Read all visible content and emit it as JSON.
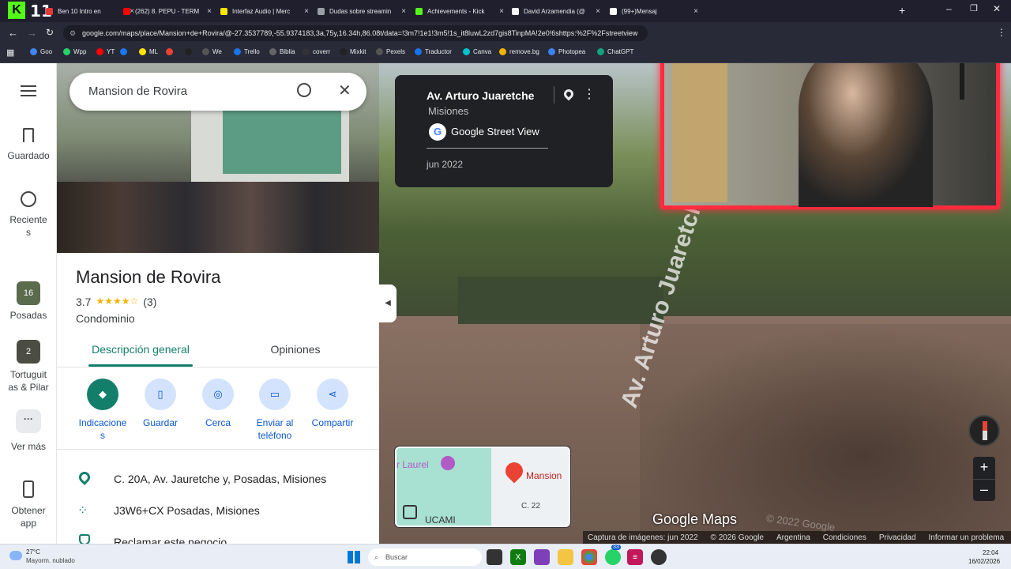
{
  "browser": {
    "tabs": [
      {
        "label": "Ben 10 Intro en",
        "color": "#e53935"
      },
      {
        "label": "(262) 8. PEPU - TERM",
        "color": "#ff0000"
      },
      {
        "label": "Interfaz Audio | Merc",
        "color": "#ffe600"
      },
      {
        "label": "Dudas sobre streamin",
        "color": "#9aa0a6"
      },
      {
        "label": "Achievements - Kick",
        "color": "#53fc18"
      },
      {
        "label": "David Arzamendia (@",
        "color": "#ffffff"
      },
      {
        "label": "(99+)Mensaj",
        "color": "#ffffff"
      }
    ],
    "url": "google.com/maps/place/Mansion+de+Rovira/@-27.3537789,-55.9374183,3a,75y,16.34h,86.08t/data=!3m7!1e1!3m5!1s_it8luwL2zd7gis8TinpMA!2e0!6shttps:%2F%2Fstreetview",
    "bookmarks": [
      "Goo",
      "Wpp",
      "YT",
      "",
      "ML",
      "",
      "",
      "We",
      "Trello",
      "Biblia",
      "coverr",
      "Mixkit",
      "Pexels",
      "Traductor",
      "Canva",
      "remove.bg",
      "Photopea",
      "ChatGPT"
    ],
    "logo_text": "11"
  },
  "search": {
    "value": "Mansion de Rovira"
  },
  "rail": {
    "saved": "Guardado",
    "recent": "Reciente\ns",
    "posadas": "Posadas",
    "posadas_badge": "16",
    "tortuguitas": "Tortuguit\nas & Pilar",
    "tortuguitas_badge": "2",
    "more": "Ver más",
    "app": "Obtener\napp"
  },
  "place": {
    "name": "Mansion de Rovira",
    "rating": "3.7",
    "stars": "★★★★☆",
    "reviews": "(3)",
    "category": "Condominio",
    "tab_overview": "Descripción general",
    "tab_reviews": "Opiniones",
    "actions": [
      "Indicacione\ns",
      "Guardar",
      "Cerca",
      "Enviar al\nteléfono",
      "Compartir"
    ],
    "address": "C. 20A, Av. Jauretche y, Posadas, Misiones",
    "plus_code": "J3W6+CX Posadas, Misiones",
    "claim": "Reclamar este negocio"
  },
  "streetview": {
    "street": "Av. Arturo Juaretche",
    "region": "Misiones",
    "source": "Google Street View",
    "date": "jun 2022",
    "road_sign": "Av. Arturo Juaretche",
    "watermark": "Google Maps",
    "faint_watermark": "© 2022 Google"
  },
  "minimap": {
    "poi": "r Laurel",
    "place": "Mansion",
    "road": "C. 22",
    "area": "UCAMI"
  },
  "footer": {
    "capture": "Captura de imágenes: jun 2022",
    "copyright": "© 2026 Google",
    "country": "Argentina",
    "terms": "Condiciones",
    "privacy": "Privacidad",
    "report": "Informar un problema"
  },
  "taskbar": {
    "temp": "27°C",
    "weather": "Mayorm. nublado",
    "search": "Buscar",
    "time": "22:04",
    "date": "16/02/2026",
    "badge": "33"
  },
  "colors": {
    "accent": "#0b57d0",
    "teal": "#137f6b",
    "pin": "#ea4335",
    "webcam_border": "#ff2a3d"
  }
}
